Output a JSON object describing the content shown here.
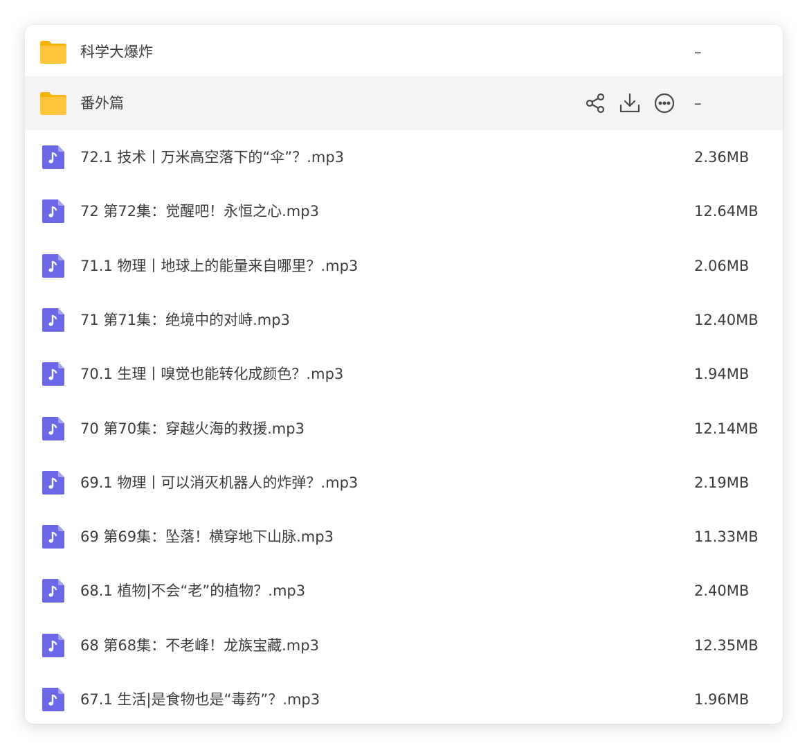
{
  "folders": [
    {
      "name": "科学大爆炸",
      "size": "–"
    },
    {
      "name": "番外篇",
      "size": "–"
    }
  ],
  "files": [
    {
      "name": "72.1 技术丨万米高空落下的“伞”？.mp3",
      "size": "2.36MB"
    },
    {
      "name": "72 第72集：觉醒吧！永恒之心.mp3",
      "size": "12.64MB"
    },
    {
      "name": "71.1 物理丨地球上的能量来自哪里？.mp3",
      "size": "2.06MB"
    },
    {
      "name": "71 第71集：绝境中的对峙.mp3",
      "size": "12.40MB"
    },
    {
      "name": "70.1 生理丨嗅觉也能转化成颜色？.mp3",
      "size": "1.94MB"
    },
    {
      "name": "70 第70集：穿越火海的救援.mp3",
      "size": "12.14MB"
    },
    {
      "name": "69.1 物理丨可以消灭机器人的炸弹？.mp3",
      "size": "2.19MB"
    },
    {
      "name": "69 第69集：坠落！横穿地下山脉.mp3",
      "size": "11.33MB"
    },
    {
      "name": "68.1 植物|不会“老”的植物？.mp3",
      "size": "2.40MB"
    },
    {
      "name": "68 第68集：不老峰！龙族宝藏.mp3",
      "size": "12.35MB"
    },
    {
      "name": "67.1 生活|是食物也是“毒药”？.mp3",
      "size": "1.96MB"
    }
  ],
  "icons": {
    "folder": "folder-icon",
    "audio_file": "audio-file-icon",
    "share": "share-icon",
    "download": "download-icon",
    "more": "more-icon"
  },
  "colors": {
    "folder": "#ffc53d",
    "audio_file": "#6b67e6",
    "action_icon": "#4a4a4a",
    "hover_row": "#f4f4f5",
    "text": "#3c3c3c"
  }
}
